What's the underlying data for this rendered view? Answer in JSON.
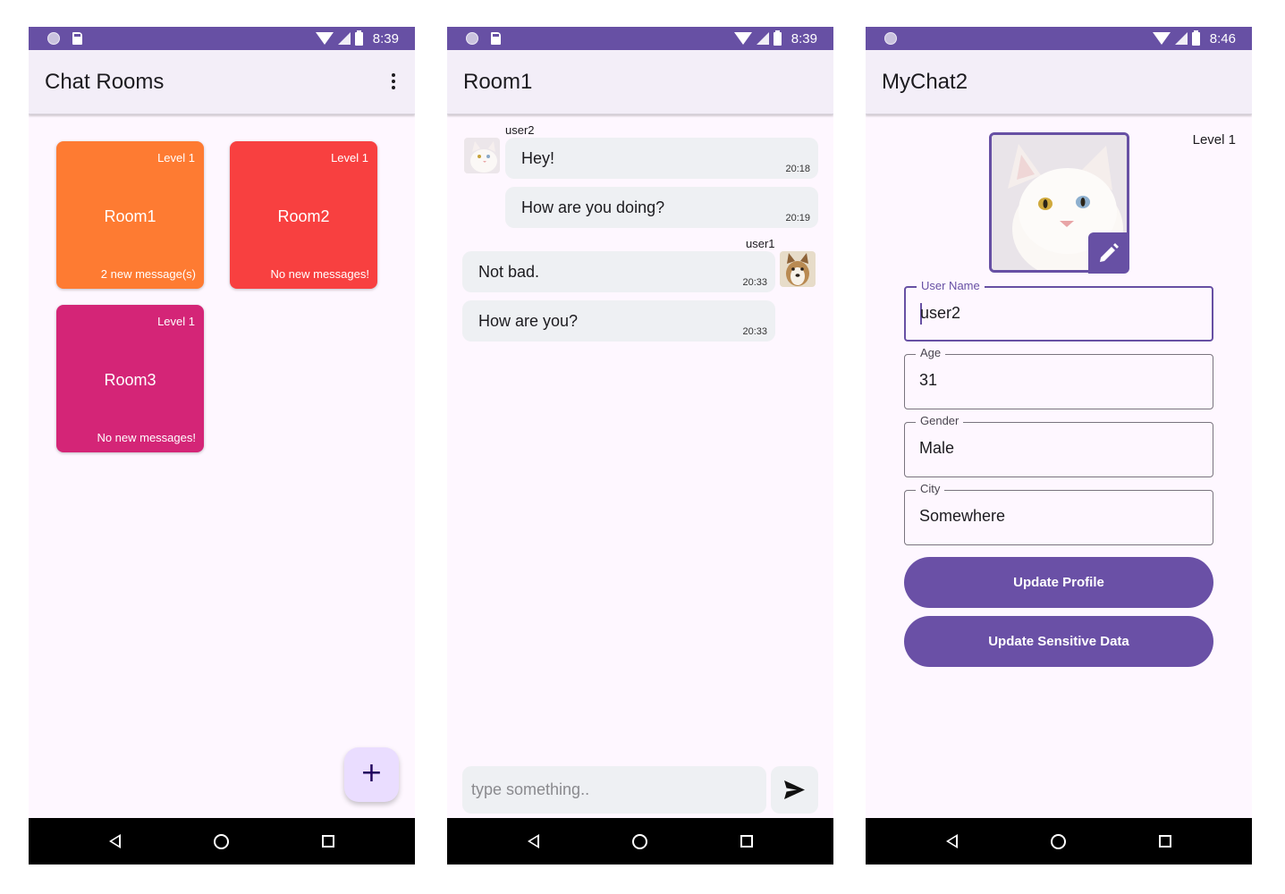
{
  "colors": {
    "primary": "#6750a4",
    "room1": "#fe7b32",
    "room2": "#f84040",
    "room3": "#d42577",
    "bubble": "#eef0f3",
    "fab": "#eaddff"
  },
  "rooms_screen": {
    "status_time": "8:39",
    "title": "Chat Rooms",
    "menu_icon": "more-vert-icon",
    "rooms": [
      {
        "level": "Level 1",
        "name": "Room1",
        "status": "2 new message(s)",
        "color": "#fe7b32"
      },
      {
        "level": "Level 1",
        "name": "Room2",
        "status": "No new messages!",
        "color": "#f84040"
      },
      {
        "level": "Level 1",
        "name": "Room3",
        "status": "No new messages!",
        "color": "#d42577"
      }
    ],
    "fab_symbol": "+"
  },
  "chat_screen": {
    "status_time": "8:39",
    "title": "Room1",
    "messages": [
      {
        "sender": "user2",
        "text": "Hey!",
        "time": "20:18",
        "side": "left"
      },
      {
        "sender": "",
        "text": "How are you doing?",
        "time": "20:19",
        "side": "left"
      },
      {
        "sender": "user1",
        "text": "Not bad.",
        "time": "20:33",
        "side": "right"
      },
      {
        "sender": "",
        "text": "How are you?",
        "time": "20:33",
        "side": "right"
      }
    ],
    "input_placeholder": "type something..",
    "send_icon": "send-icon"
  },
  "profile_screen": {
    "status_time": "8:46",
    "title": "MyChat2",
    "level": "Level 1",
    "fields": [
      {
        "label": "User Name",
        "value": "user2"
      },
      {
        "label": "Age",
        "value": "31"
      },
      {
        "label": "Gender",
        "value": "Male"
      },
      {
        "label": "City",
        "value": "Somewhere"
      }
    ],
    "update_profile_label": "Update Profile",
    "update_sensitive_label": "Update Sensitive Data"
  }
}
